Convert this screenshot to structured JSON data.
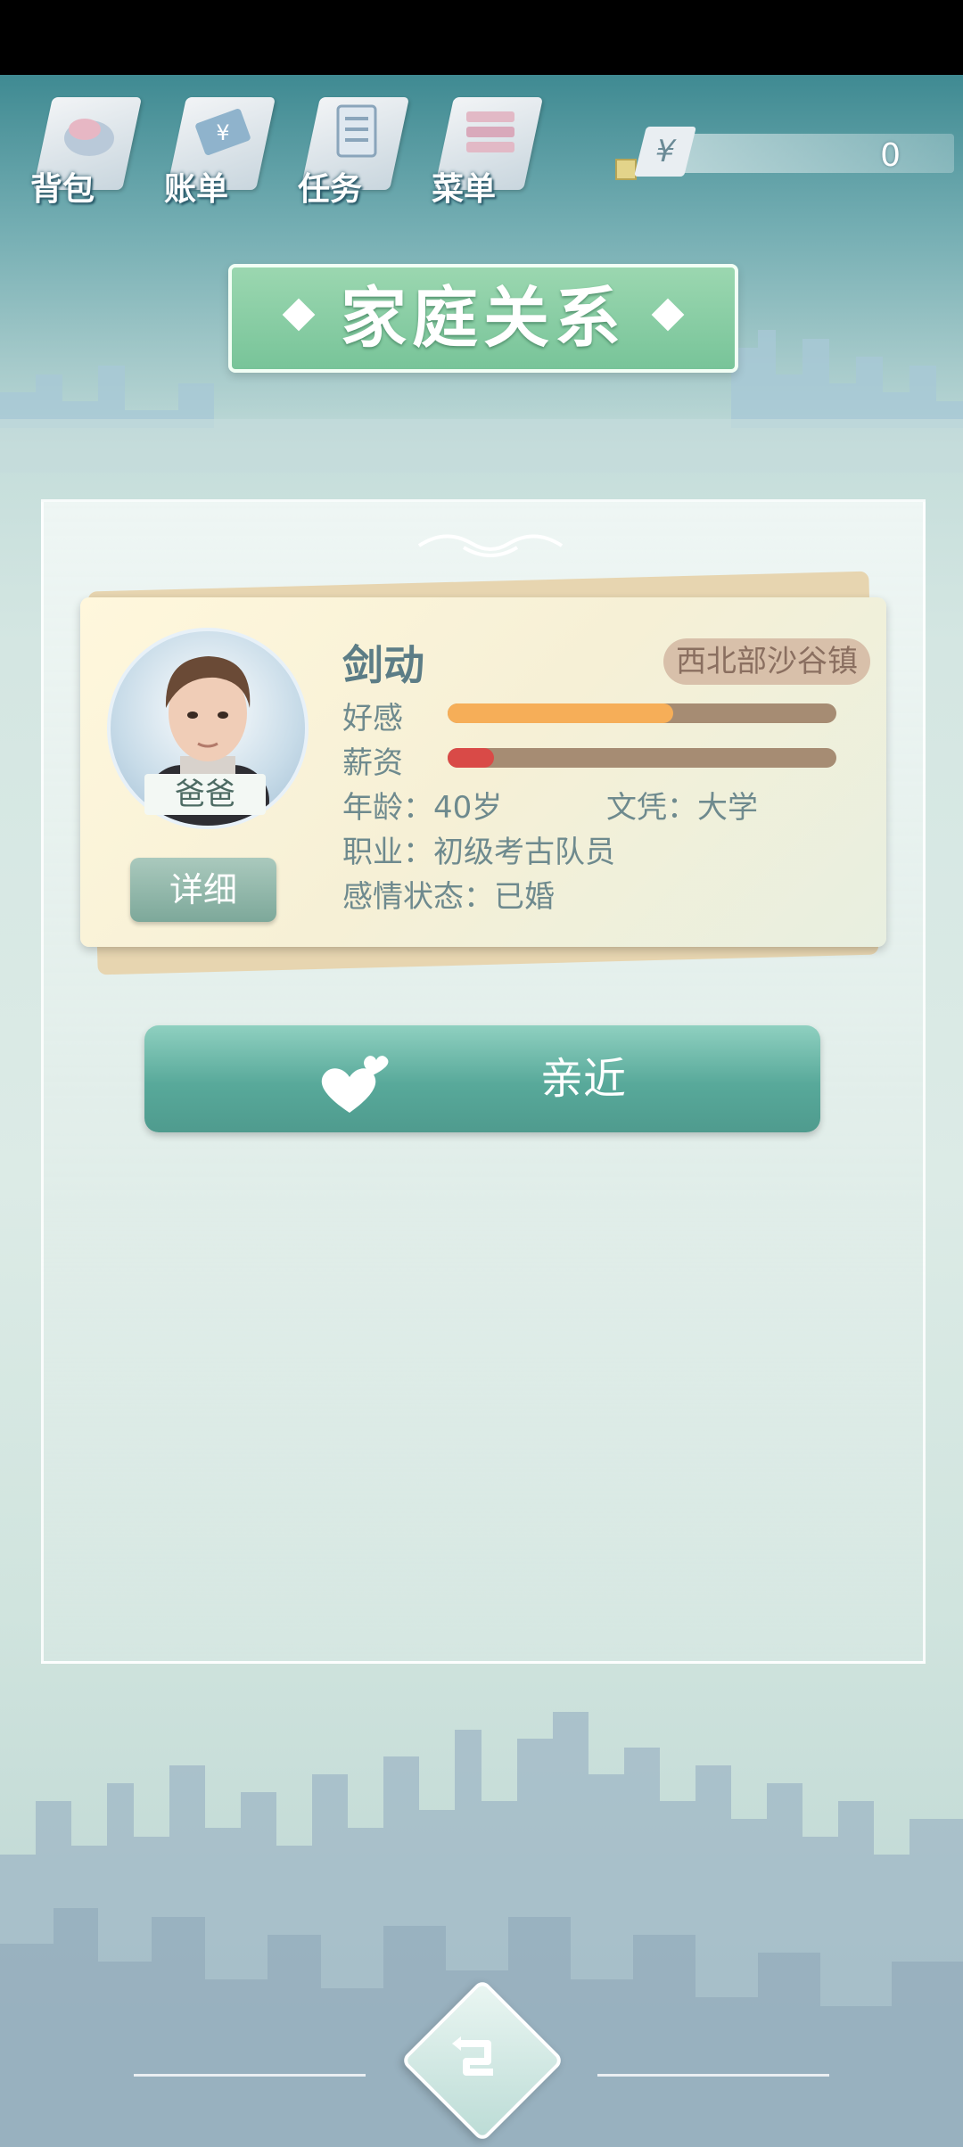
{
  "nav": {
    "items": [
      {
        "label": "背包",
        "icon": "bag-icon"
      },
      {
        "label": "账单",
        "icon": "bill-icon"
      },
      {
        "label": "任务",
        "icon": "task-list-icon"
      },
      {
        "label": "菜单",
        "icon": "menu-stack-icon"
      }
    ]
  },
  "money": {
    "symbol": "¥",
    "value": "0"
  },
  "title": "家庭关系",
  "member": {
    "relation": "爸爸",
    "name": "剑动",
    "region": "西北部沙谷镇",
    "favor_label": "好感",
    "favor_level": 0.58,
    "salary_label": "薪资",
    "salary_level": 0.12,
    "age": "年龄：40岁",
    "education": "文凭：大学",
    "job": "职业：初级考古队员",
    "marital": "感情状态：已婚",
    "detail_label": "详细"
  },
  "action": {
    "label": "亲近",
    "icon": "hearts-icon"
  },
  "colors": {
    "favor": "#f6ae58",
    "salary": "#d94a47",
    "accent": "#5aaa9b"
  }
}
